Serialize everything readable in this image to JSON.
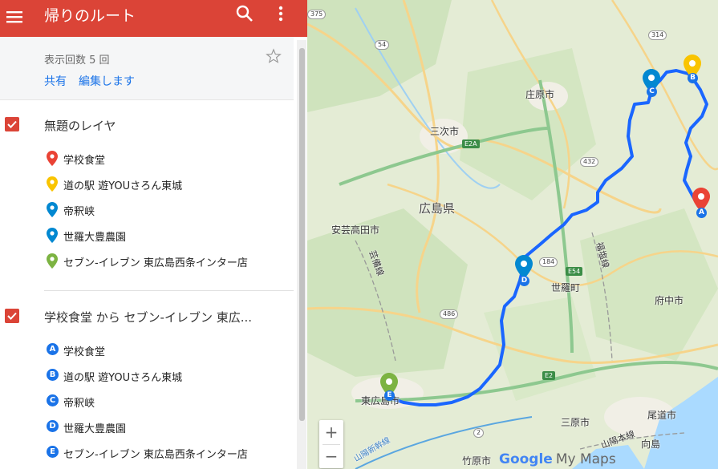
{
  "header": {
    "title": "帰りのルート",
    "menu_icon": "hamburger-icon",
    "search_icon": "search-icon",
    "more_icon": "more-vert-icon",
    "color": "#db4437"
  },
  "info": {
    "views": "表示回数 5 回",
    "share": "共有",
    "edit": "編集します"
  },
  "layers": [
    {
      "title": "無題のレイヤ",
      "items": [
        {
          "label": "学校食堂",
          "color": "#ea4335"
        },
        {
          "label": "道の駅 遊YOUさろん東城",
          "color": "#f9c400"
        },
        {
          "label": "帝釈峡",
          "color": "#0288d1"
        },
        {
          "label": "世羅大豊農園",
          "color": "#0288d1"
        },
        {
          "label": "セブン-イレブン 東広島西条インター店",
          "color": "#7cb342"
        }
      ]
    },
    {
      "title": "学校食堂 から セブン-イレブン 東広...",
      "items": [
        {
          "letter": "A",
          "label": "学校食堂"
        },
        {
          "letter": "B",
          "label": "道の駅 遊YOUさろん東城"
        },
        {
          "letter": "C",
          "label": "帝釈峡"
        },
        {
          "letter": "D",
          "label": "世羅大豊農園"
        },
        {
          "letter": "E",
          "label": "セブン-イレブン 東広島西条インター店"
        }
      ]
    }
  ],
  "map": {
    "labels": {
      "shobara": "庄原市",
      "miyoshi": "三次市",
      "hiroshima_pref": "広島県",
      "akitakata": "安芸高田市",
      "sera": "世羅町",
      "fuchu": "府中市",
      "higashihiroshima": "東広島市",
      "mihara": "三原市",
      "onomichi": "尾道市",
      "takehara": "竹原市",
      "mukaishima": "向島",
      "geibi_line": "芸備線",
      "fukuen_line": "福塩線",
      "sanyo_line": "山陽本線",
      "sanyo_shinkansen": "山陽新幹線"
    },
    "routes": [
      "375",
      "314",
      "54",
      "432",
      "184",
      "486",
      "2",
      "E2A",
      "E54",
      "E2"
    ],
    "zoom_in": "+",
    "zoom_out": "−",
    "logo_text": "Google",
    "logo_suffix": "My Maps",
    "markers": [
      {
        "letter": "A",
        "color": "#ea4335"
      },
      {
        "letter": "B",
        "color": "#f9c400"
      },
      {
        "letter": "C",
        "color": "#0288d1"
      },
      {
        "letter": "D",
        "color": "#0288d1"
      },
      {
        "letter": "E",
        "color": "#7cb342"
      }
    ],
    "route_color": "#1a66ff"
  }
}
